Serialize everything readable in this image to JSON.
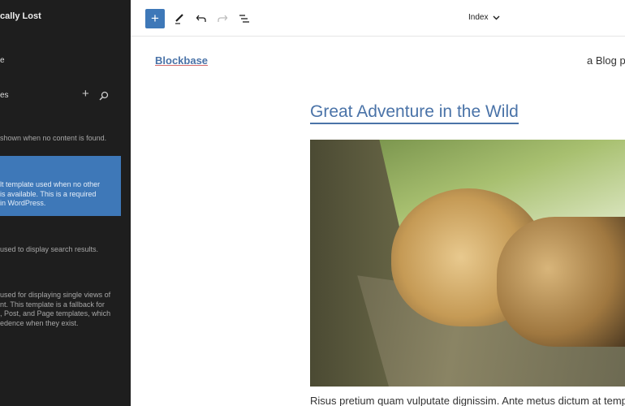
{
  "sidebar": {
    "site_title": "cally Lost",
    "nav_item": "e",
    "section_title": "es",
    "templates": [
      {
        "desc_lines": [
          "shown when no content is found."
        ]
      },
      {
        "desc_lines": [
          "lt template used when no other",
          "is available. This is a required",
          "in WordPress."
        ],
        "active": true
      },
      {
        "desc_lines": [
          "used to display search results."
        ]
      },
      {
        "desc_lines": [
          "used for displaying single views of",
          "nt. This template is a fallback for",
          ", Post, and Page templates, which",
          "edence when they exist."
        ]
      }
    ]
  },
  "toolbar": {
    "template_name": "Index"
  },
  "content": {
    "site_name": "Blockbase",
    "tagline": "a Blog p",
    "post_title": "Great Adventure in the Wild",
    "excerpt": "Risus pretium quam vulputate dignissim. Ante metus dictum at tempor"
  },
  "colors": {
    "accent": "#3e78b8",
    "sidebar_bg": "#1e1e1e",
    "link": "#4a73a8"
  }
}
